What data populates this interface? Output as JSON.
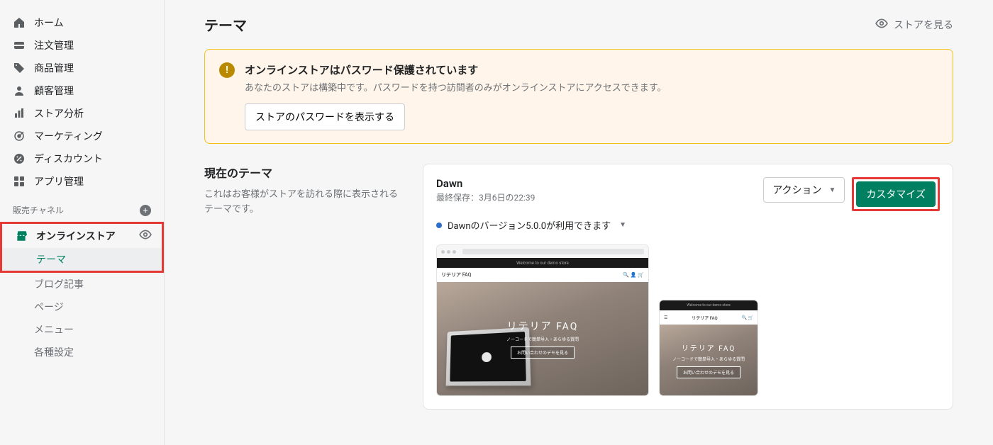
{
  "sidebar": {
    "items": [
      {
        "label": "ホーム"
      },
      {
        "label": "注文管理"
      },
      {
        "label": "商品管理"
      },
      {
        "label": "顧客管理"
      },
      {
        "label": "ストア分析"
      },
      {
        "label": "マーケティング"
      },
      {
        "label": "ディスカウント"
      },
      {
        "label": "アプリ管理"
      }
    ],
    "channel_header": "販売チャネル",
    "online_store": "オンラインストア",
    "sub": [
      {
        "label": "テーマ",
        "active": true
      },
      {
        "label": "ブログ記事"
      },
      {
        "label": "ページ"
      },
      {
        "label": "メニュー"
      },
      {
        "label": "各種設定"
      }
    ]
  },
  "header": {
    "title": "テーマ",
    "view_store": "ストアを見る"
  },
  "banner": {
    "title": "オンラインストアはパスワード保護されています",
    "text": "あなたのストアは構築中です。パスワードを持つ訪問者のみがオンラインストアにアクセスできます。",
    "button": "ストアのパスワードを表示する"
  },
  "current_theme": {
    "section_title": "現在のテーマ",
    "section_desc": "これはお客様がストアを訪れる際に表示されるテーマです。",
    "name": "Dawn",
    "last_saved": "最終保存：3月6日の22:39",
    "version_notice": "Dawnのバージョン5.0.0が利用できます",
    "action_label": "アクション",
    "customize_label": "カスタマイズ"
  },
  "preview": {
    "welcome": "Welcome to our demo store",
    "brand": "リテリア FAQ",
    "hero_title": "リテリア FAQ",
    "hero_sub": "ノーコードで簡単导入・あらゆる質問",
    "hero_btn": "お問い合わせのデモを見る"
  }
}
